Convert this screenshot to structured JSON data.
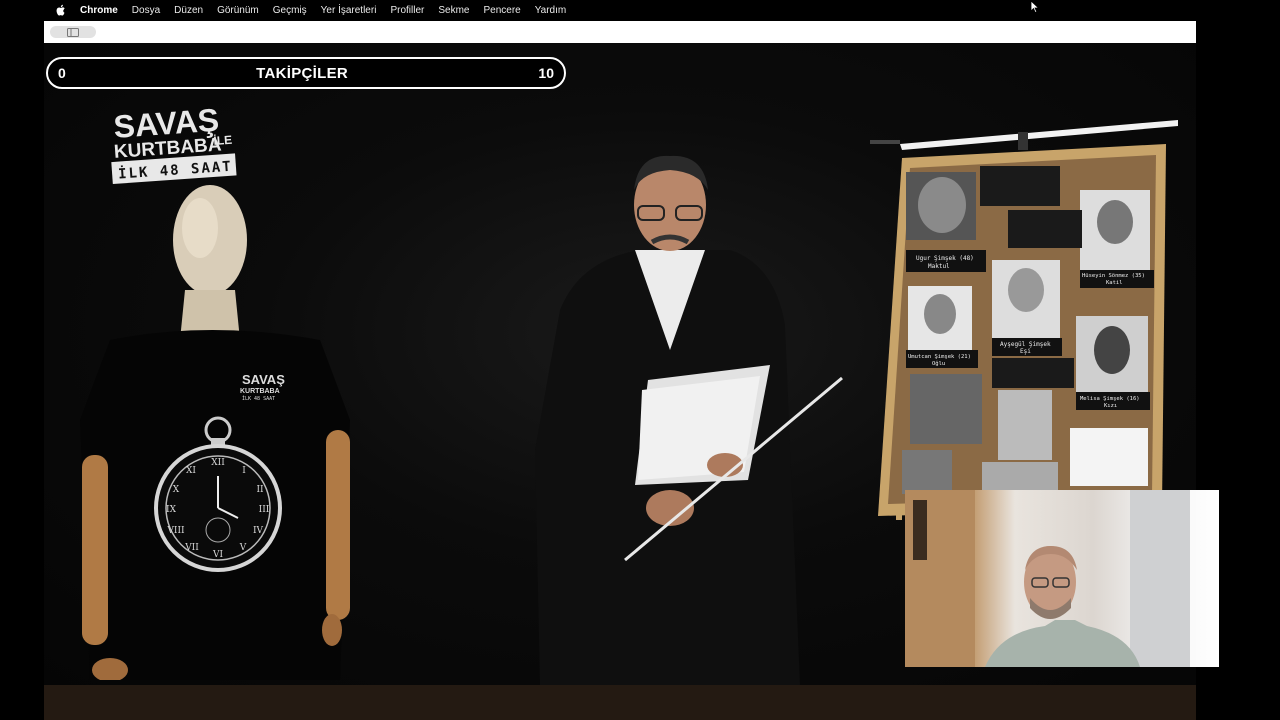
{
  "menubar": {
    "app": "Chrome",
    "items": [
      "Dosya",
      "Düzen",
      "Görünüm",
      "Geçmiş",
      "Yer İşaretleri",
      "Profiller",
      "Sekme",
      "Pencere",
      "Yardım"
    ]
  },
  "followers": {
    "label": "TAKİPÇİLER",
    "min": "0",
    "max": "10"
  },
  "logo": {
    "line1": "SAVAŞ",
    "line2": "KURTBABA",
    "line2_suffix": "İLE",
    "line3": "İLK 48 SAAT"
  },
  "shirt_logo": {
    "line1": "SAVAŞ",
    "line2": "KURTBABA",
    "line3": "İLK 48 SAAT"
  },
  "board": {
    "notes": [
      "Ugur Şimşek (48)",
      "Maktul",
      "Hüseyin Sönmez (35)",
      "Katil",
      "Ayşegül Şimşek",
      "Eşi",
      "Umutcan Şimşek (21)",
      "Oğlu",
      "Melisa Şimşek (16)",
      "Kızı"
    ]
  },
  "colors": {
    "board_frame": "#c8a46a",
    "cork": "#8b6a45",
    "lamp": "#f2f2f2",
    "followers_border": "#ffffff"
  }
}
